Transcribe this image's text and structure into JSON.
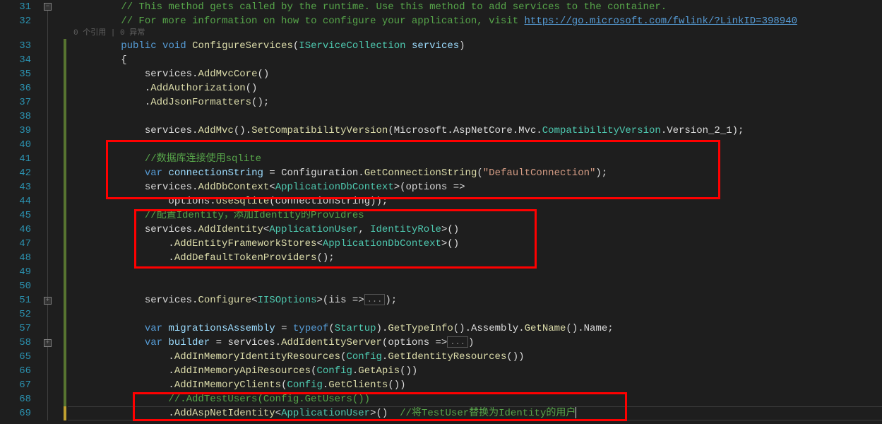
{
  "lineNumbers": [
    "31",
    "32",
    "",
    "33",
    "34",
    "35",
    "36",
    "37",
    "38",
    "39",
    "40",
    "41",
    "42",
    "43",
    "44",
    "45",
    "46",
    "47",
    "48",
    "49",
    "50",
    "51",
    "52",
    "57",
    "58",
    "65",
    "66",
    "67",
    "68",
    "69"
  ],
  "lines": {
    "l31": "// This method gets called by the runtime. Use this method to add services to the container.",
    "l32a": "// For more information on how to configure your application, visit ",
    "l32b": "https://go.microsoft.com/fwlink/?LinkID=398940",
    "hint": "0 个引用 | 0 异常",
    "l33_kw1": "public",
    "l33_kw2": "void",
    "l33_m": "ConfigureServices",
    "l33_t": "IServiceCollection",
    "l33_p": "services",
    "l34": "{",
    "l35_a": "services.",
    "l35_m": "AddMvcCore",
    "l36_m": "AddAuthorization",
    "l37_m": "AddJsonFormatters",
    "l39_a": "services.",
    "l39_m1": "AddMvc",
    "l39_m2": "SetCompatibilityVersion",
    "l39_b": "Microsoft.AspNetCore.Mvc.",
    "l39_t": "CompatibilityVersion",
    "l39_c": ".Version_2_1",
    "l41": "//数据库连接使用sqlite",
    "l42_kw": "var",
    "l42_v": "connectionString",
    "l42_eq": " = ",
    "l42_a": "Configuration.",
    "l42_m": "GetConnectionString",
    "l42_s": "\"DefaultConnection\"",
    "l43_a": "services.",
    "l43_m": "AddDbContext",
    "l43_t": "ApplicationDbContext",
    "l43_b": "(options =>",
    "l44_a": "options.",
    "l44_m": "UseSqlite",
    "l44_b": "(connectionString",
    "l44_c": "))",
    "l45": "//配置Identity，添加Identity的Providres",
    "l46_a": "services.",
    "l46_m": "AddIdentity",
    "l46_t1": "ApplicationUser",
    "l46_t2": "IdentityRole",
    "l47_m": "AddEntityFrameworkStores",
    "l47_t": "ApplicationDbContext",
    "l48_m": "AddDefaultTokenProviders",
    "l51_a": "services.",
    "l51_m": "Configure",
    "l51_t": "IISOptions",
    "l51_b": "(iis =>",
    "l51_box": "...",
    "l57_kw": "var",
    "l57_v": "migrationsAssembly",
    "l57_eq": " = ",
    "l57_tk": "typeof",
    "l57_t": "Startup",
    "l57_a": ".",
    "l57_m1": "GetTypeInfo",
    "l57_b": ".Assembly.",
    "l57_m2": "GetName",
    "l57_c": ".Name;",
    "l58_kw": "var",
    "l58_v": "builder",
    "l58_eq": " = services.",
    "l58_m": "AddIdentityServer",
    "l58_b": "(options =>",
    "l58_box": "...",
    "l65_m": "AddInMemoryIdentityResources",
    "l65_t": "Config",
    "l65_m2": "GetIdentityResources",
    "l66_m": "AddInMemoryApiResources",
    "l66_t": "Config",
    "l66_m2": "GetApis",
    "l67_m": "AddInMemoryClients",
    "l67_t": "Config",
    "l67_m2": "GetClients",
    "l68": "//.AddTestUsers(Config.GetUsers())",
    "l69_m": "AddAspNetIdentity",
    "l69_t": "ApplicationUser",
    "l69_c": "  //将TestUser替换为Identity的用户"
  }
}
